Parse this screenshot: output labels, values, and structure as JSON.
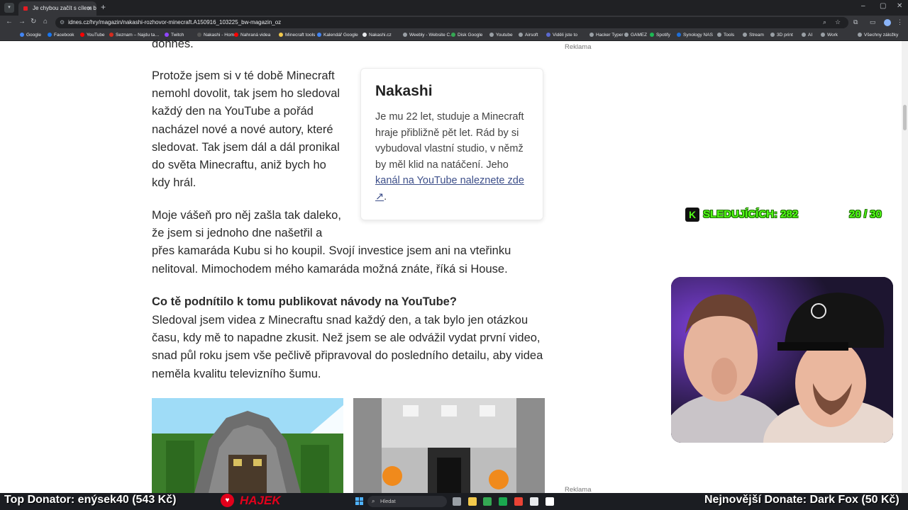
{
  "browser": {
    "tab_title": "Je chybou začít s cílem být bohatý…",
    "address": "idnes.cz/hry/magazin/nakashi-rozhovor-minecraft.A150916_103225_bw-magazin_oz",
    "bookmarks": [
      "Google",
      "Facebook",
      "YouTube",
      "Seznam – Najdu ta…",
      "Twitch",
      "Nakashi - Home",
      "Nahraná videa",
      "Minecraft tools",
      "Kalendář Google",
      "Nakashi.cz",
      "Weebly - Website C…",
      "Disk Google",
      "Youtube",
      "Airsoft",
      "Viděli jste to",
      "Hacker Typer",
      "GAMEZ",
      "Spotify",
      "Synology NAS",
      "Tools",
      "Stream",
      "3D print",
      "AI",
      "Work",
      "Všechny záložky"
    ],
    "bookmark_colors": [
      "#4285f4",
      "#1877f2",
      "#ff0000",
      "#d52b1e",
      "#9146ff",
      "#555555",
      "#ff0000",
      "#f2c94c",
      "#4285f4",
      "#e8eaed",
      "#9aa0a6",
      "#34a853",
      "#9aa0a6",
      "#9aa0a6",
      "#5b6ad0",
      "#9aa0a6",
      "#9aa0a6",
      "#1db954",
      "#1e6fd9",
      "#9aa0a6",
      "#9aa0a6",
      "#9aa0a6",
      "#9aa0a6",
      "#9aa0a6",
      "#9aa0a6"
    ]
  },
  "article": {
    "top_fragment": "dohnes.",
    "paragraph1": "Protože jsem si v té době Minecraft nemohl dovolit, tak jsem ho sledoval každý den na YouTube a pořád nacházel nové a nové autory, které sledovat. Tak jsem dál a dál pronikal do světa Minecraftu, aniž bych ho kdy hrál.",
    "paragraph2": "Moje vášeň pro něj zašla tak daleko, že jsem si jednoho dne našetřil a přes kamaráda Kubu si ho koupil. Svojí investice jsem ani na vteřinku nelitoval. Mimochodem mého kamaráda možná znáte, říká si House.",
    "question": "Co tě podnítilo k tomu publikovat návody na YouTube?",
    "answer": "Sledoval jsem videa z Minecraftu snad každý den, a tak bylo jen otázkou času, kdy mě to napadne zkusit. Než jsem se ale odvážil vydat první video, snad půl roku jsem vše pečlivě připravoval do posledního detailu, aby videa neměla kvalitu televizního šumu."
  },
  "profile_card": {
    "name": "Nakashi",
    "text": "Je mu 22 let, studuje a Minecraft hraje přibližně pět let. Rád by si vybudoval vlastní studio, v němž by měl klid na natáčení. Jeho ",
    "link_text": "kanál na YouTube naleznete zde",
    "link_suffix": "."
  },
  "ads": {
    "label_top": "Reklama",
    "label_bottom": "Reklama"
  },
  "overlay": {
    "kick_letter": "K",
    "followers": "SLEDUJÍCÍCH: 282",
    "goal": "20 / 30",
    "top_donator": "Top Donator: enýsek40  (543 Kč)",
    "hajek": "HAJEK",
    "latest_donate": "Nejnovější Donate: Dark Fox  (50 Kč)",
    "accent_color": "#53fc18"
  },
  "taskbar": {
    "search_placeholder": "Hledat",
    "app_colors": [
      "#9aa0a6",
      "#f2c94c",
      "#34a853",
      "#1aa84f",
      "#ea4335",
      "#e8eaed",
      "#ffffff"
    ]
  }
}
